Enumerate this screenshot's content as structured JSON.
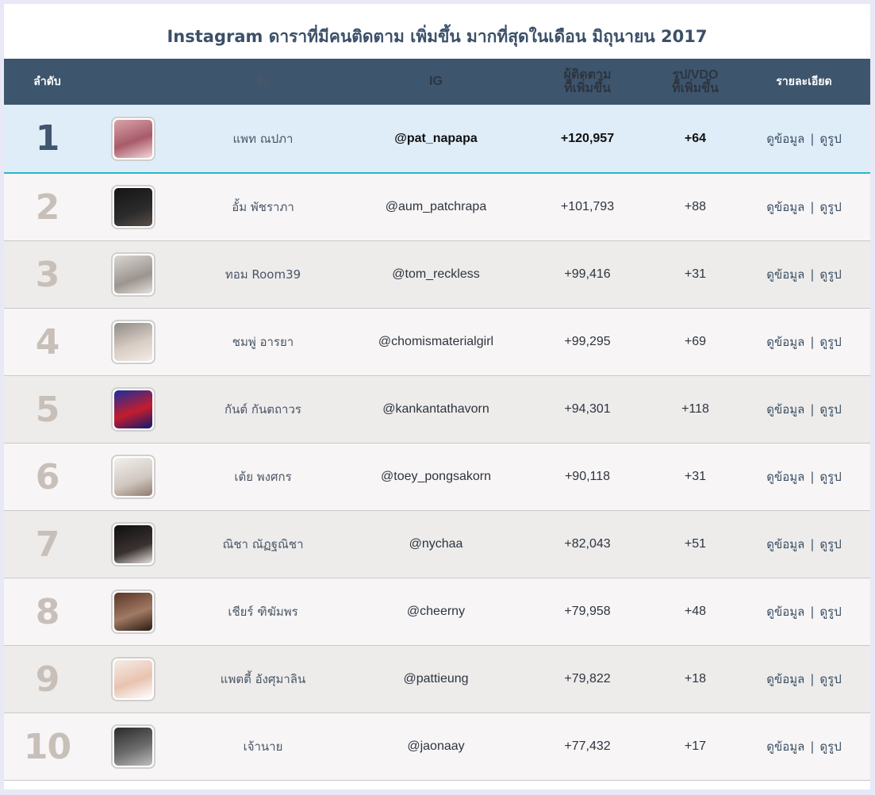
{
  "page": {
    "title": "Instagram ดาราที่มีคนติดตาม เพิ่มขึ้น มากที่สุดในเดือน มิถุนายน 2017"
  },
  "colors": {
    "header_bg": "#3d566d",
    "highlight_row": "#dfedf8",
    "accent_line": "#28b8c8",
    "rank_muted": "#c8bfb9"
  },
  "table": {
    "headers": {
      "rank": "ลำดับ",
      "name": "ชื่อ",
      "ig": "IG",
      "followers_line1": "ผู้ติดตาม",
      "followers_line2": "ที่เพิ่มขึ้น",
      "posts_line1": "รูป/VDO",
      "posts_line2": "ที่เพิ่มขึ้น",
      "details": "รายละเอียด"
    },
    "rows": [
      {
        "rank": "1",
        "name": "แพท ณปภา",
        "ig": "@pat_napapa",
        "followers_gain": "+120,957",
        "posts_gain": "+64",
        "info_link": "ดูข้อมูล",
        "photo_link": "ดูรูป",
        "photo_icon": "profile-photo"
      },
      {
        "rank": "2",
        "name": "อั้ม พัชราภา",
        "ig": "@aum_patchrapa",
        "followers_gain": "+101,793",
        "posts_gain": "+88",
        "info_link": "ดูข้อมูล",
        "photo_link": "ดูรูป",
        "photo_icon": "profile-photo"
      },
      {
        "rank": "3",
        "name": "ทอม Room39",
        "ig": "@tom_reckless",
        "followers_gain": "+99,416",
        "posts_gain": "+31",
        "info_link": "ดูข้อมูล",
        "photo_link": "ดูรูป",
        "photo_icon": "profile-photo"
      },
      {
        "rank": "4",
        "name": "ชมพู่ อารยา",
        "ig": "@chomismaterialgirl",
        "followers_gain": "+99,295",
        "posts_gain": "+69",
        "info_link": "ดูข้อมูล",
        "photo_link": "ดูรูป",
        "photo_icon": "profile-photo"
      },
      {
        "rank": "5",
        "name": "กันต์ กันตถาวร",
        "ig": "@kankantathavorn",
        "followers_gain": "+94,301",
        "posts_gain": "+118",
        "info_link": "ดูข้อมูล",
        "photo_link": "ดูรูป",
        "photo_icon": "profile-photo"
      },
      {
        "rank": "6",
        "name": "เต้ย พงศกร",
        "ig": "@toey_pongsakorn",
        "followers_gain": "+90,118",
        "posts_gain": "+31",
        "info_link": "ดูข้อมูล",
        "photo_link": "ดูรูป",
        "photo_icon": "profile-photo"
      },
      {
        "rank": "7",
        "name": "ณิชา ณัฏฐณิชา",
        "ig": "@nychaa",
        "followers_gain": "+82,043",
        "posts_gain": "+51",
        "info_link": "ดูข้อมูล",
        "photo_link": "ดูรูป",
        "photo_icon": "profile-photo"
      },
      {
        "rank": "8",
        "name": "เชียร์ ฑิฆัมพร",
        "ig": "@cheerny",
        "followers_gain": "+79,958",
        "posts_gain": "+48",
        "info_link": "ดูข้อมูล",
        "photo_link": "ดูรูป",
        "photo_icon": "profile-photo"
      },
      {
        "rank": "9",
        "name": "แพตตี้ อังศุมาลิน",
        "ig": "@pattieung",
        "followers_gain": "+79,822",
        "posts_gain": "+18",
        "info_link": "ดูข้อมูล",
        "photo_link": "ดูรูป",
        "photo_icon": "profile-photo"
      },
      {
        "rank": "10",
        "name": "เจ้านาย",
        "ig": "@jaonaay",
        "followers_gain": "+77,432",
        "posts_gain": "+17",
        "info_link": "ดูข้อมูล",
        "photo_link": "ดูรูป",
        "photo_icon": "profile-photo"
      }
    ]
  }
}
